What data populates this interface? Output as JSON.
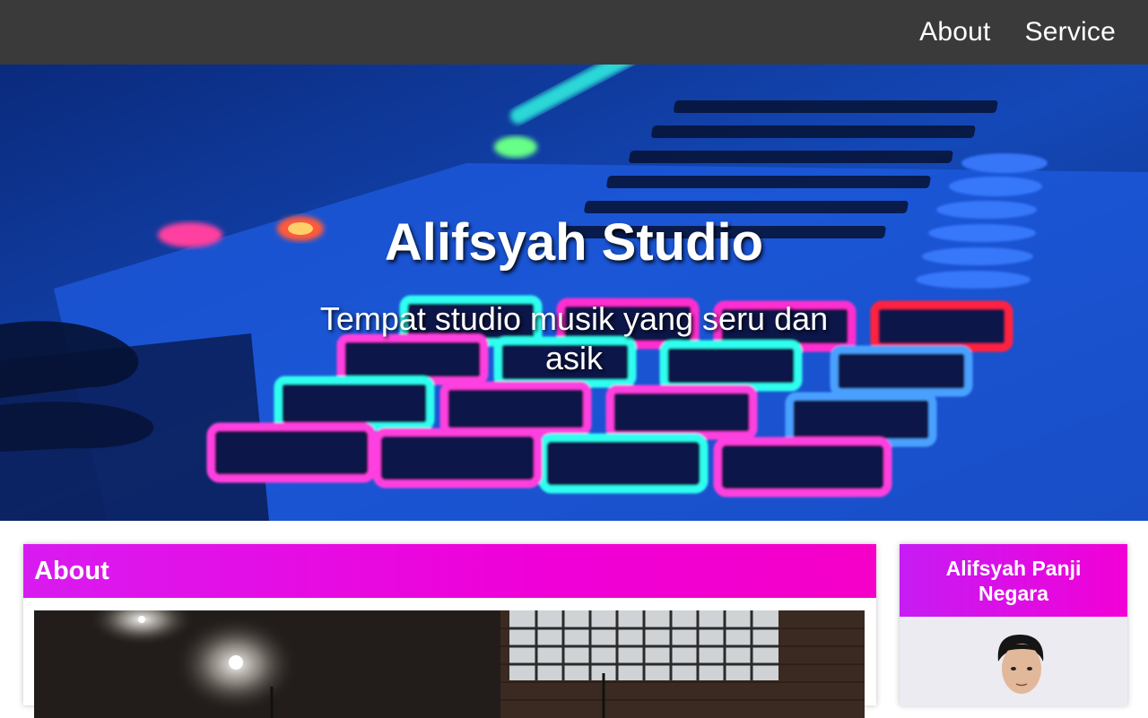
{
  "nav": {
    "items": [
      {
        "label": "About"
      },
      {
        "label": "Service"
      }
    ]
  },
  "hero": {
    "title": "Alifsyah Studio",
    "subtitle": "Tempat studio musik yang seru dan asik",
    "image": "midi-controller-pads-photo"
  },
  "about": {
    "heading": "About",
    "image": "studio-stage-photo"
  },
  "profile": {
    "name": "Alifsyah Panji Negara",
    "photo": "profile-portrait-photo"
  },
  "colors": {
    "nav_bg": "#3a3a3a",
    "accent_magenta": "#f000d8",
    "accent_purple": "#c61cf4"
  }
}
